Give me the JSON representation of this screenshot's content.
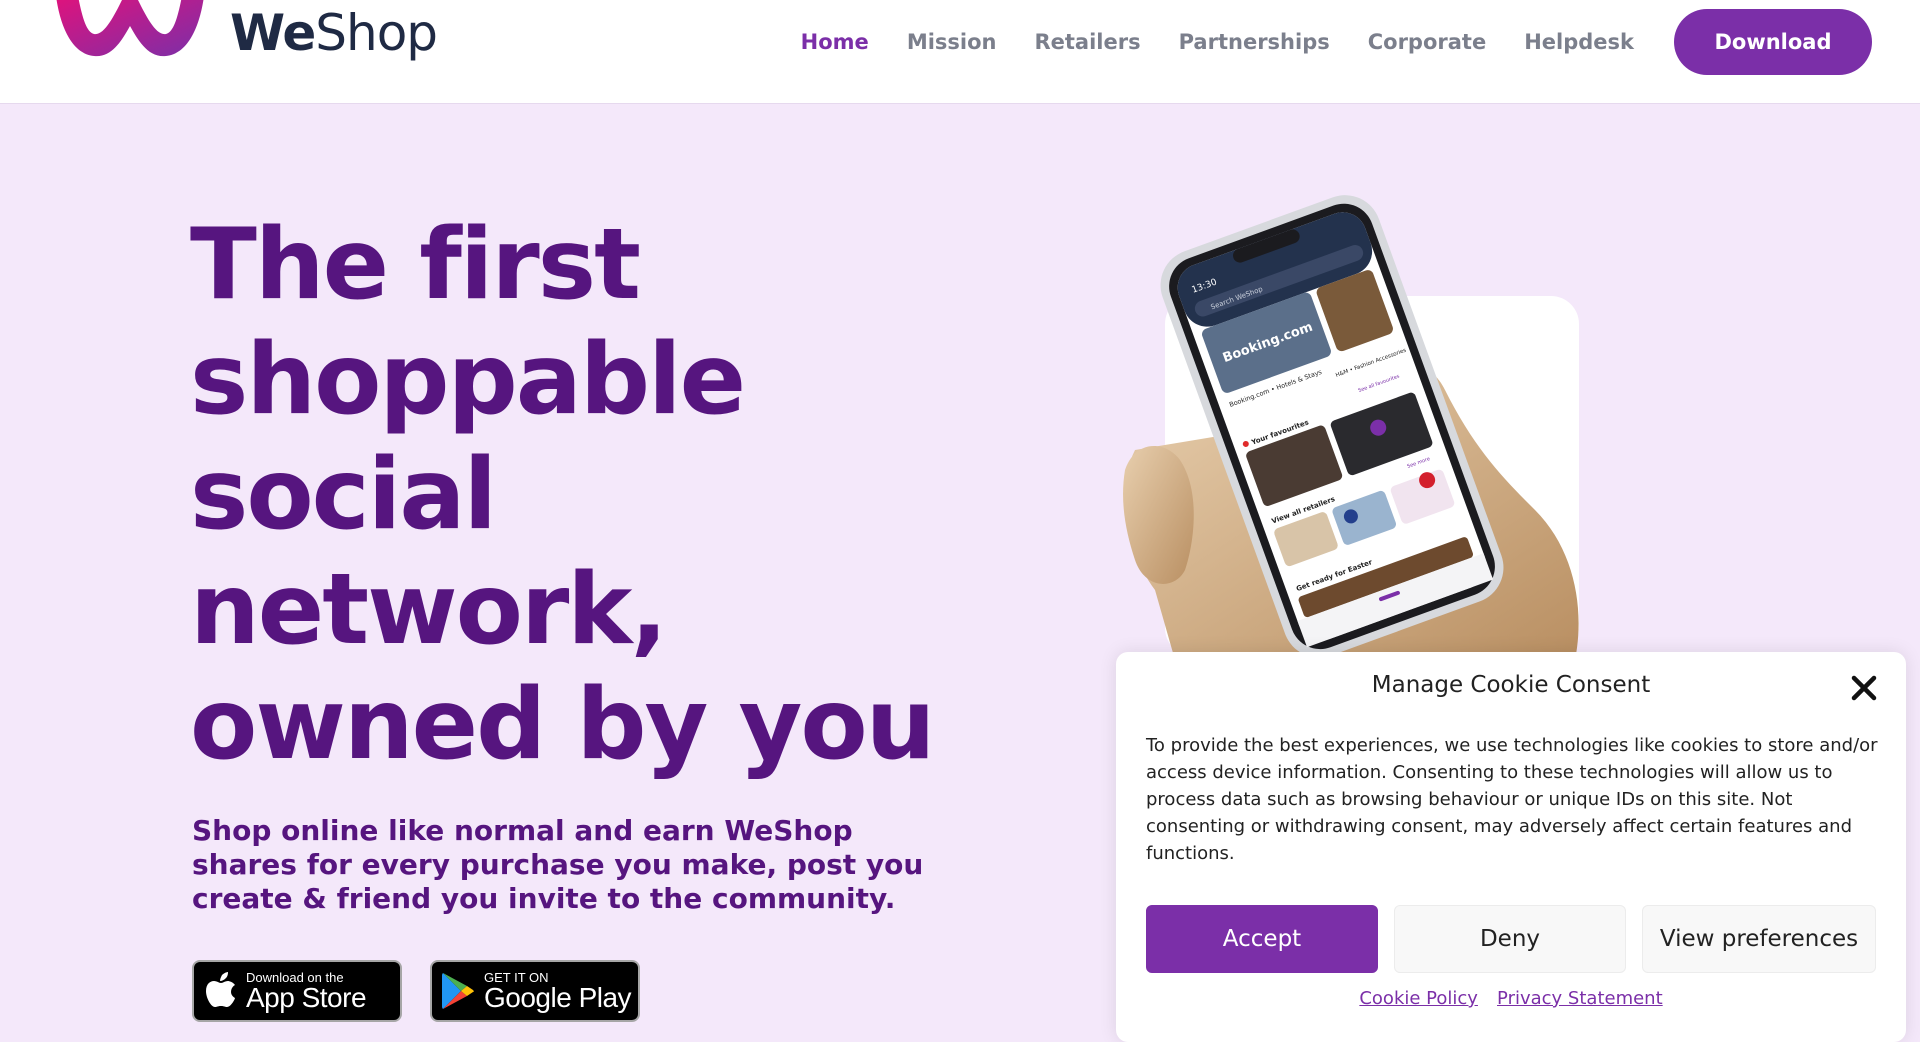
{
  "brand": {
    "name_bold": "We",
    "name_regular": "Shop",
    "accent": "#7b2fa8",
    "headline_color": "#56157f"
  },
  "nav": {
    "items": [
      {
        "label": "Home",
        "active": true
      },
      {
        "label": "Mission"
      },
      {
        "label": "Retailers"
      },
      {
        "label": "Partnerships"
      },
      {
        "label": "Corporate"
      },
      {
        "label": "Helpdesk"
      }
    ],
    "download_label": "Download"
  },
  "hero": {
    "title_lines": [
      "The first",
      "shoppable",
      "social",
      "network,",
      "owned by you"
    ],
    "subtitle": "Shop online like normal and earn WeShop shares for every purchase you make, post you create & friend you invite to the community."
  },
  "badges": {
    "appstore": {
      "small": "Download on the",
      "big": "App Store"
    },
    "googleplay": {
      "small": "GET IT ON",
      "big": "Google Play"
    }
  },
  "phone": {
    "time": "13:30",
    "search_placeholder": "Search WeShop",
    "cards": [
      {
        "label": "Booking.com"
      },
      {
        "label": "Booking.com • Hotels & Stays"
      },
      {
        "label": "H&M • Fashion Accessories"
      }
    ],
    "favourites_label": "Your favourites",
    "retailers_label": "View all retailers",
    "easter_label": "Get ready for Easter",
    "see_more": "See more",
    "see_all": "See all favourites"
  },
  "cookie": {
    "title": "Manage Cookie Consent",
    "body": "To provide the best experiences, we use technologies like cookies to store and/or access device information. Consenting to these technologies will allow us to process data such as browsing behaviour or unique IDs on this site. Not consenting or withdrawing consent, may adversely affect certain features and functions.",
    "accept": "Accept",
    "deny": "Deny",
    "preferences": "View preferences",
    "cookie_policy": "Cookie Policy",
    "privacy": "Privacy Statement"
  }
}
